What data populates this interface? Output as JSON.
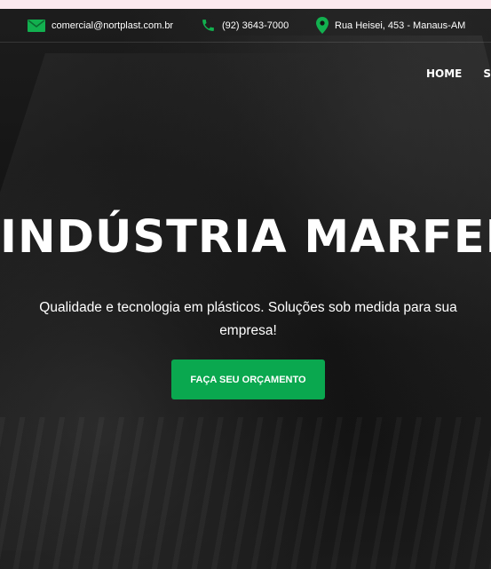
{
  "topbar": {
    "email": "comercial@nortplast.com.br",
    "phone": "(92) 3643-7000",
    "address": "Rua Heisei, 453 - Manaus-AM",
    "icons": [
      "mail-icon",
      "phone-icon",
      "map-pin-icon"
    ],
    "icon_color": "#12b04f"
  },
  "nav": {
    "items": [
      "HOME",
      "SO"
    ]
  },
  "hero": {
    "title": "INDÚSTRIA MARFEL",
    "subtitle": "Qualidade e tecnologia em plásticos. Soluções sob medida para sua empresa!",
    "cta_label": "FAÇA SEU ORÇAMENTO",
    "cta_color": "#0aa84f"
  }
}
